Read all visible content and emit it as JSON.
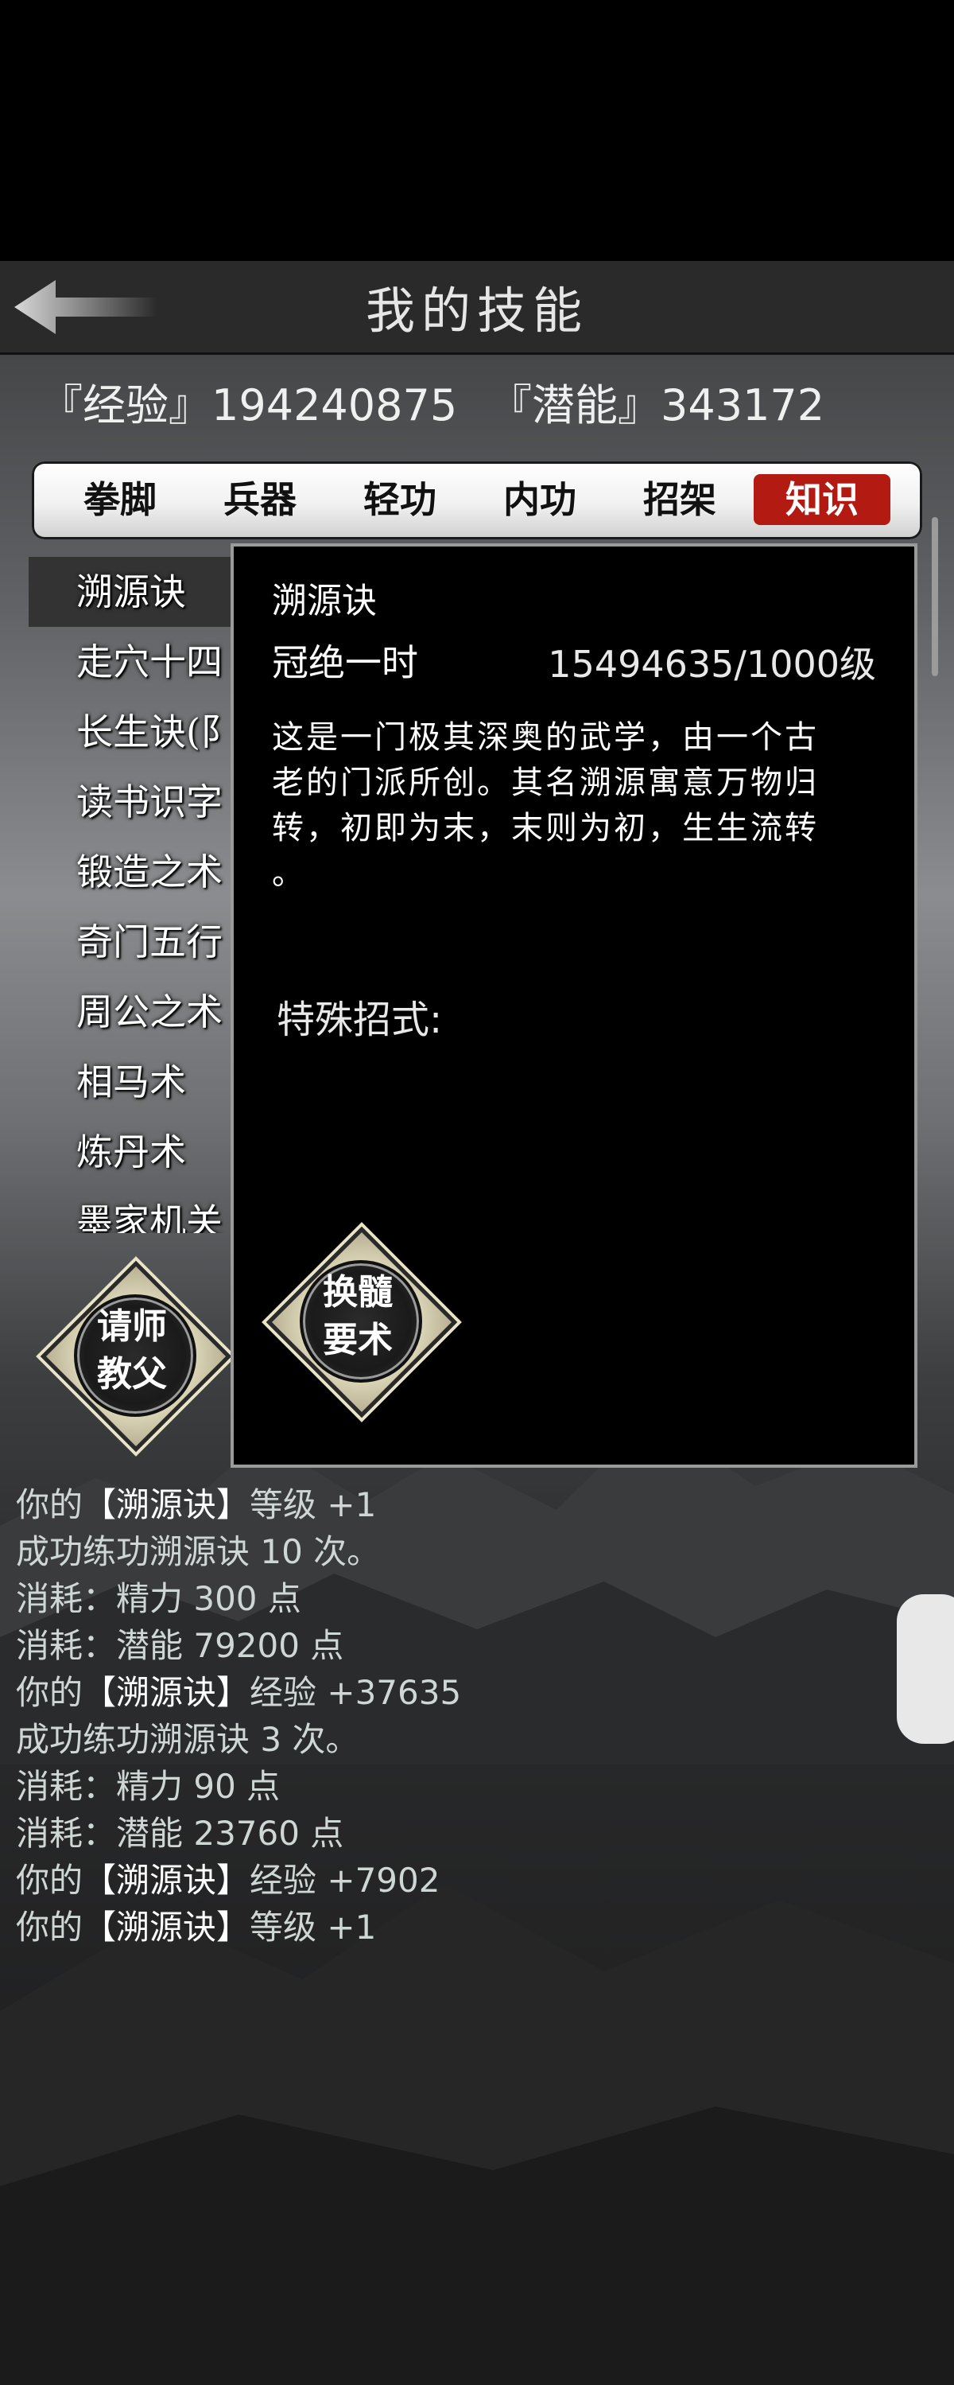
{
  "header": {
    "title": "我的技能"
  },
  "stats": {
    "exp": "『经验』194240875",
    "potential": "『潜能』343172"
  },
  "tabs": [
    {
      "label": "拳脚"
    },
    {
      "label": "兵器"
    },
    {
      "label": "轻功"
    },
    {
      "label": "内功"
    },
    {
      "label": "招架"
    },
    {
      "label": "知识",
      "active": true
    }
  ],
  "skills": [
    {
      "label": "溯源诀"
    },
    {
      "label": "走穴十四"
    },
    {
      "label": "长生诀(阝"
    },
    {
      "label": "读书识字"
    },
    {
      "label": "锻造之术"
    },
    {
      "label": "奇门五行"
    },
    {
      "label": "周公之术"
    },
    {
      "label": "相马术"
    },
    {
      "label": "炼丹术"
    },
    {
      "label": "墨家机关"
    }
  ],
  "detail": {
    "name": "溯源诀",
    "rank": "冠绝一时",
    "level": "15494635/1000级",
    "desc_lines": [
      "这是一门极其深奥的武学，由一个古",
      "老的门派所创。其名溯源寓意万物归",
      "转，初即为末，末则为初，生生流转",
      "。"
    ],
    "special_label": "特殊招式:",
    "action_line1": "换髓",
    "action_line2": "要术"
  },
  "teacher_button": {
    "line1": "请师",
    "line2": "教父"
  },
  "log": [
    {
      "pre": "你的",
      "name": "【溯源诀】",
      "post": "等级 +1"
    },
    {
      "pre": "成功练功溯源诀 10 次。",
      "name": "",
      "post": ""
    },
    {
      "pre": "消耗：精力 300 点",
      "name": "",
      "post": ""
    },
    {
      "pre": "消耗：潜能 79200 点",
      "name": "",
      "post": ""
    },
    {
      "pre": "你的",
      "name": "【溯源诀】",
      "post": "经验 +37635"
    },
    {
      "pre": "成功练功溯源诀 3 次。",
      "name": "",
      "post": ""
    },
    {
      "pre": "消耗：精力 90 点",
      "name": "",
      "post": ""
    },
    {
      "pre": "消耗：潜能 23760 点",
      "name": "",
      "post": ""
    },
    {
      "pre": "你的",
      "name": "【溯源诀】",
      "post": "经验 +7902"
    },
    {
      "pre": "你的",
      "name": "【溯源诀】",
      "post": "等级 +1"
    }
  ],
  "icons": {
    "back": "back-arrow-icon"
  },
  "colors": {
    "active_tab": "#b21a12",
    "panel_border": "#9a9a9a"
  }
}
